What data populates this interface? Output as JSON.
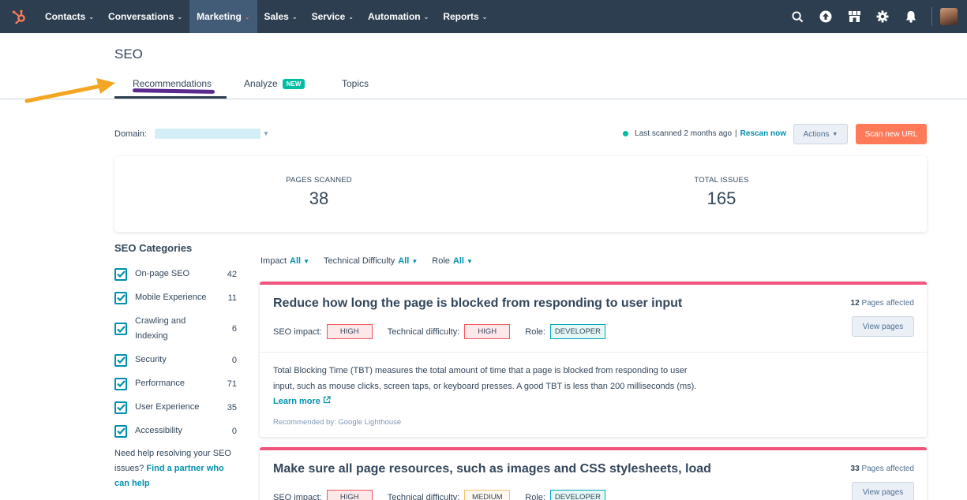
{
  "nav": {
    "items": [
      {
        "label": "Contacts",
        "active": false
      },
      {
        "label": "Conversations",
        "active": false
      },
      {
        "label": "Marketing",
        "active": true
      },
      {
        "label": "Sales",
        "active": false
      },
      {
        "label": "Service",
        "active": false
      },
      {
        "label": "Automation",
        "active": false
      },
      {
        "label": "Reports",
        "active": false
      }
    ],
    "icons": [
      "search-icon",
      "upgrade-icon",
      "marketplace-icon",
      "settings-icon",
      "notifications-icon"
    ]
  },
  "page": {
    "title": "SEO",
    "tabs": {
      "recommendations": "Recommendations",
      "analyze": "Analyze",
      "analyze_badge": "NEW",
      "topics": "Topics"
    }
  },
  "domain": {
    "label": "Domain:"
  },
  "scan": {
    "status": "Last scanned 2 months ago",
    "separator": "|",
    "rescan": "Rescan now",
    "actions": "Actions",
    "scan_new_url": "Scan new URL"
  },
  "stats": {
    "pages_scanned_label": "PAGES SCANNED",
    "pages_scanned_value": "38",
    "total_issues_label": "TOTAL ISSUES",
    "total_issues_value": "165"
  },
  "categories": {
    "title": "SEO Categories",
    "items": [
      {
        "name": "On-page SEO",
        "count": "42"
      },
      {
        "name": "Mobile Experience",
        "count": "11"
      },
      {
        "name": "Crawling and Indexing",
        "count": "6"
      },
      {
        "name": "Security",
        "count": "0"
      },
      {
        "name": "Performance",
        "count": "71"
      },
      {
        "name": "User Experience",
        "count": "35"
      },
      {
        "name": "Accessibility",
        "count": "0"
      }
    ],
    "help_text": "Need help resolving your SEO issues?",
    "help_link": "Find a partner who can help"
  },
  "filters": {
    "impact_label": "Impact",
    "impact_value": "All",
    "difficulty_label": "Technical Difficulty",
    "difficulty_value": "All",
    "role_label": "Role",
    "role_value": "All"
  },
  "recommendations": [
    {
      "title": "Reduce how long the page is blocked from responding to user input",
      "pages_count": "12",
      "pages_label": "Pages affected",
      "view_pages": "View pages",
      "impact_label": "SEO impact:",
      "impact": "HIGH",
      "difficulty_label": "Technical difficulty:",
      "difficulty": "HIGH",
      "role_label": "Role:",
      "role": "DEVELOPER",
      "description": "Total Blocking Time (TBT) measures the total amount of time that a page is blocked from responding to user input, such as mouse clicks, screen taps, or keyboard presses. A good TBT is less than 200 milliseconds (ms).",
      "learn_more": "Learn more",
      "recommended_by": "Recommended by: Google Lighthouse"
    },
    {
      "title": "Make sure all page resources, such as images and CSS stylesheets, load",
      "pages_count": "33",
      "pages_label": "Pages affected",
      "view_pages": "View pages",
      "impact_label": "SEO impact:",
      "impact": "HIGH",
      "difficulty_label": "Technical difficulty:",
      "difficulty": "MEDIUM",
      "role_label": "Role:",
      "role": "DEVELOPER"
    }
  ],
  "colors": {
    "nav_bg": "#2d3e50",
    "accent_teal": "#00bda5",
    "link": "#0091ae",
    "orange": "#ff7a59",
    "card_top": "#f2547d",
    "annotation_arrow": "#f4a623",
    "annotation_underline": "#5b2a8f"
  }
}
